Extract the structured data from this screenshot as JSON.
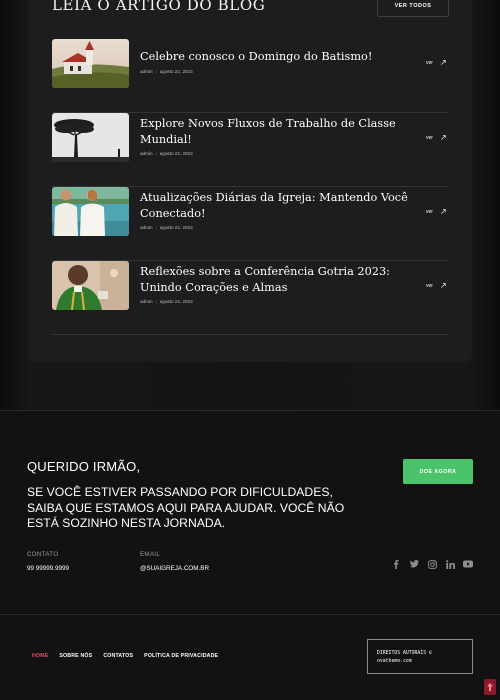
{
  "blog": {
    "title": "LEIA O ARTIGO DO BLOG",
    "view_all_label": "VER TODOS",
    "posts": [
      {
        "title": "Celebre conosco o Domingo do Batismo!",
        "author": "admin",
        "date": "agosto 22, 2023",
        "link_label": "ver",
        "thumbnail": "church-on-hill-icon"
      },
      {
        "title": "Explore Novos Fluxos de Trabalho de Classe Mundial!",
        "author": "admin",
        "date": "agosto 22, 2023",
        "link_label": "ver",
        "thumbnail": "tree-silhouette-icon"
      },
      {
        "title": "Atualizações Diárias da Igreja: Mantendo Você Conectado!",
        "author": "admin",
        "date": "agosto 22, 2023",
        "link_label": "ver",
        "thumbnail": "baptism-water-icon"
      },
      {
        "title": "Reflexões sobre a Conferência Gotria 2023: Unindo Corações e Almas",
        "author": "admin",
        "date": "agosto 22, 2023",
        "link_label": "ver",
        "thumbnail": "priest-icon"
      }
    ]
  },
  "cta": {
    "heading": "QUERIDO IRMÃO,",
    "message": "SE VOCÊ ESTIVER PASSANDO POR DIFICULDADES, SAIBA QUE ESTAMOS AQUI PARA AJUDAR. VOCÊ NÃO ESTÁ SOZINHO NESTA JORNADA.",
    "donate_label": "DOE AGORA"
  },
  "contact": {
    "phone_label": "CONTATO",
    "phone": "99 99999.9999",
    "email_label": "EMAIL",
    "email": "@SUAIGREJA.COM.BR"
  },
  "socials": [
    "facebook-icon",
    "twitter-icon",
    "instagram-icon",
    "linkedin-icon",
    "youtube-icon"
  ],
  "footer": {
    "nav": [
      {
        "label": "HOME",
        "active": true
      },
      {
        "label": "SOBRE NÓS",
        "active": false
      },
      {
        "label": "CONTATOS",
        "active": false
      },
      {
        "label": "POLÍTICA DE PRIVACIDADE",
        "active": false
      }
    ],
    "copyright_line1": "DIREITOS AUTORAIS ©",
    "copyright_line2": "ovatheme.com"
  },
  "colors": {
    "accent_green": "#4bc36b",
    "active_nav": "#e24a6a",
    "to_top_bg": "#8a1b2a"
  }
}
